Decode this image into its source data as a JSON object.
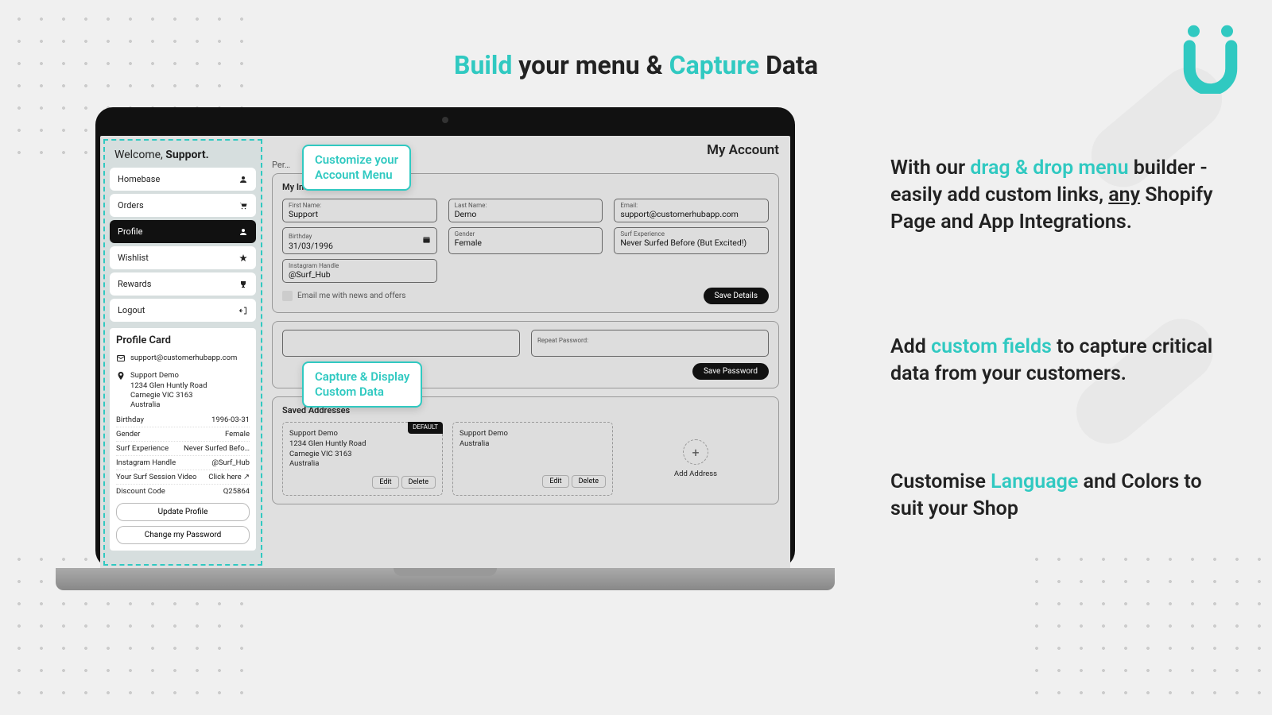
{
  "colors": {
    "accent": "#30c9c1"
  },
  "title": {
    "p1": "Build",
    "p2": " your menu & ",
    "p3": "Capture",
    "p4": " Data"
  },
  "callouts": {
    "c1a": "Customize your",
    "c1b": "Account Menu",
    "c2a": "Capture & Display",
    "c2b": "Custom Data"
  },
  "side": {
    "s1a": "With our ",
    "s1b": "drag & drop menu",
    "s1c": " builder - easily add custom links, ",
    "s1d": "any",
    "s1e": " Shopify Page and App Integrations.",
    "s2a": "Add ",
    "s2b": "custom fields",
    "s2c": " to capture critical data from your customers.",
    "s3a": "Customise ",
    "s3b": "Language",
    "s3c": " and Colors to suit your Shop"
  },
  "screen": {
    "welcome_pre": "Welcome, ",
    "welcome_name": "Support.",
    "page_title": "My Account",
    "nav": [
      {
        "label": "Homebase",
        "active": false
      },
      {
        "label": "Orders",
        "active": false
      },
      {
        "label": "Profile",
        "active": true
      },
      {
        "label": "Wishlist",
        "active": false
      },
      {
        "label": "Rewards",
        "active": false
      },
      {
        "label": "Logout",
        "active": false
      }
    ],
    "profile_card": {
      "title": "Profile Card",
      "email": "support@customerhubapp.com",
      "name": "Support Demo",
      "addr1": "1234 Glen Huntly Road",
      "addr2": "Carnegie VIC 3163",
      "addr3": "Australia",
      "kv": [
        {
          "k": "Birthday",
          "v": "1996-03-31"
        },
        {
          "k": "Gender",
          "v": "Female"
        },
        {
          "k": "Surf Experience",
          "v": "Never Surfed Befo…"
        },
        {
          "k": "Instagram Handle",
          "v": "@Surf_Hub"
        },
        {
          "k": "Your Surf Session Video",
          "v": "Click here ↗"
        },
        {
          "k": "Discount Code",
          "v": "Q25864"
        }
      ],
      "btn_update": "Update Profile",
      "btn_changepw": "Change my Password"
    },
    "my_info": {
      "title": "My Information",
      "first_name_label": "First Name:",
      "first_name": "Support",
      "last_name_label": "Last Name:",
      "last_name": "Demo",
      "email_label": "Email:",
      "email": "support@customerhubapp.com",
      "birthday_label": "Birthday",
      "birthday": "31/03/1996",
      "gender_label": "Gender",
      "gender": "Female",
      "surf_label": "Surf Experience",
      "surf": "Never Surfed Before (But Excited!)",
      "insta_label": "Instagram Handle",
      "insta": "@Surf_Hub",
      "chk_label": "Email me with news and offers",
      "save_btn": "Save Details"
    },
    "pw": {
      "repeat_label": "Repeat Password:",
      "save_btn": "Save Password"
    },
    "addresses": {
      "title": "Saved Addresses",
      "default_tag": "DEFAULT",
      "a1": {
        "name": "Support Demo",
        "l1": "1234 Glen Huntly Road",
        "l2": "Carnegie VIC 3163",
        "l3": "Australia"
      },
      "a2": {
        "name": "Support Demo",
        "l1": "Australia"
      },
      "edit": "Edit",
      "delete": "Delete",
      "add": "Add Address"
    }
  }
}
